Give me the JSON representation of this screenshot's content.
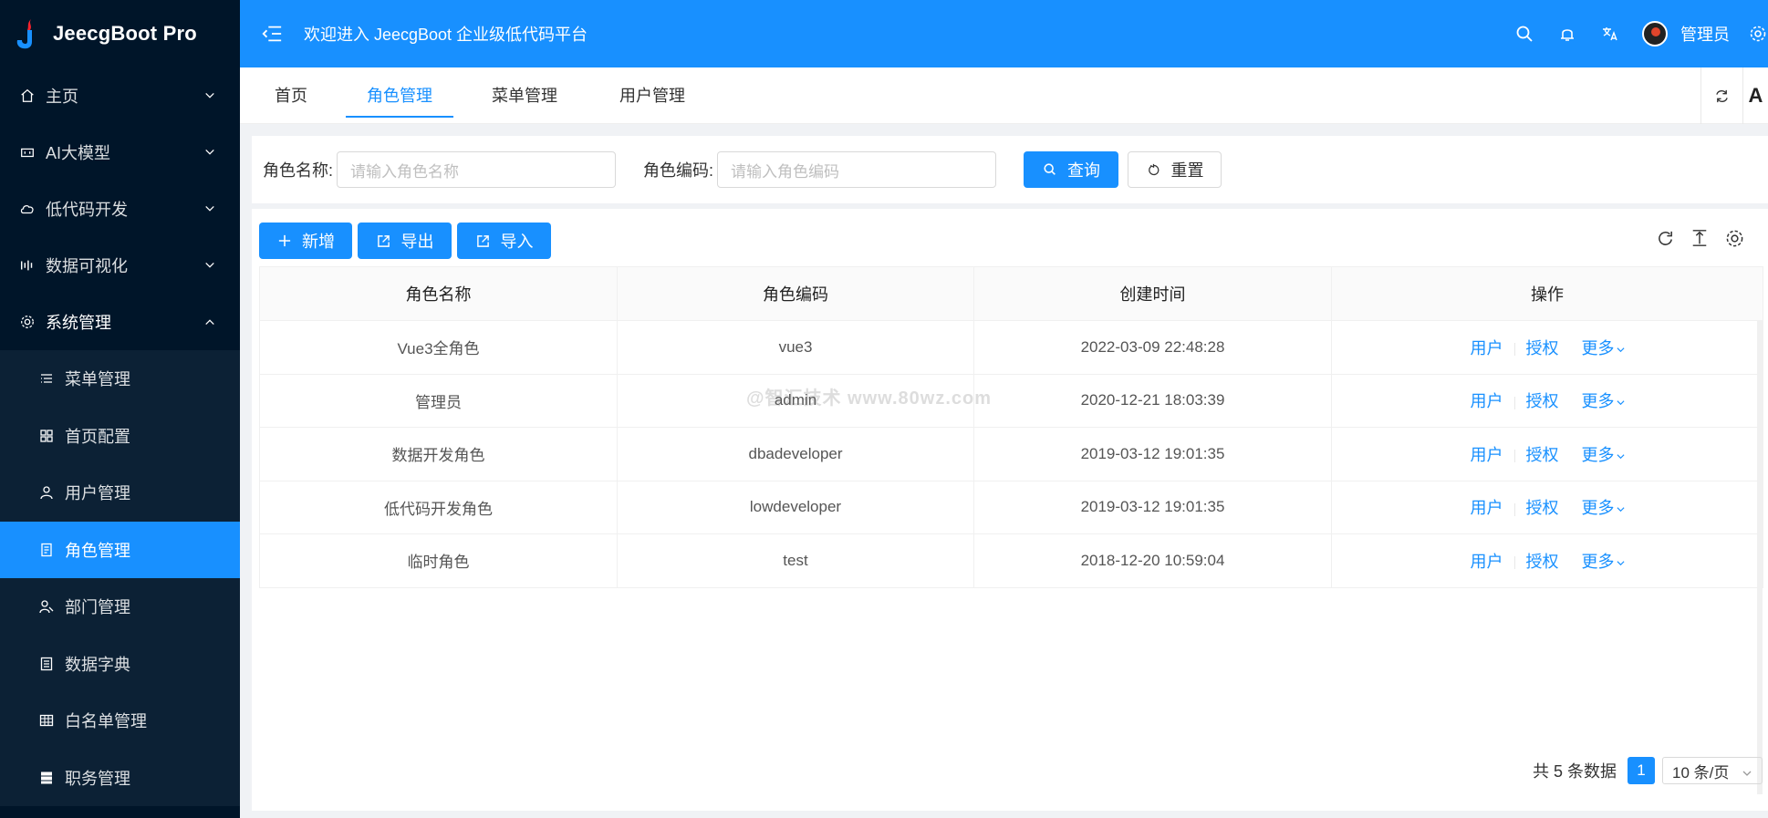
{
  "app": {
    "title": "JeecgBoot Pro",
    "welcome": "欢迎进入 JeecgBoot 企业级低代码平台",
    "username": "管理员"
  },
  "sidebar": {
    "groups": [
      {
        "label": "主页",
        "icon": "home-icon"
      },
      {
        "label": "AI大模型",
        "icon": "ai-icon"
      },
      {
        "label": "低代码开发",
        "icon": "cloud-icon"
      },
      {
        "label": "数据可视化",
        "icon": "chart-icon"
      },
      {
        "label": "系统管理",
        "icon": "gear-icon"
      }
    ],
    "sub_items": [
      {
        "label": "菜单管理",
        "icon": "menu-list-icon"
      },
      {
        "label": "首页配置",
        "icon": "grid-icon"
      },
      {
        "label": "用户管理",
        "icon": "user-icon"
      },
      {
        "label": "角色管理",
        "icon": "role-icon"
      },
      {
        "label": "部门管理",
        "icon": "department-icon"
      },
      {
        "label": "数据字典",
        "icon": "dictionary-icon"
      },
      {
        "label": "白名单管理",
        "icon": "table-icon"
      },
      {
        "label": "职务管理",
        "icon": "position-icon"
      }
    ]
  },
  "tabs": [
    "首页",
    "角色管理",
    "菜单管理",
    "用户管理"
  ],
  "tab_tool_letter": "A",
  "search": {
    "role_name_label": "角色名称:",
    "role_name_placeholder": "请输入角色名称",
    "role_code_label": "角色编码:",
    "role_code_placeholder": "请输入角色编码",
    "query_label": "查询",
    "reset_label": "重置"
  },
  "toolbar": {
    "add_label": "新增",
    "export_label": "导出",
    "import_label": "导入"
  },
  "table": {
    "columns": [
      "角色名称",
      "角色编码",
      "创建时间",
      "操作"
    ],
    "rows": [
      {
        "name": "Vue3全角色",
        "code": "vue3",
        "created": "2022-03-09 22:48:28"
      },
      {
        "name": "管理员",
        "code": "admin",
        "created": "2020-12-21 18:03:39"
      },
      {
        "name": "数据开发角色",
        "code": "dbadeveloper",
        "created": "2019-03-12 19:01:35"
      },
      {
        "name": "低代码开发角色",
        "code": "lowdeveloper",
        "created": "2019-03-12 19:01:35"
      },
      {
        "name": "临时角色",
        "code": "test",
        "created": "2018-12-20 10:59:04"
      }
    ],
    "actions": {
      "users": "用户",
      "authorize": "授权",
      "more": "更多"
    }
  },
  "pagination": {
    "total_text": "共 5 条数据",
    "current_page": "1",
    "page_size": "10 条/页"
  },
  "watermark": "@智汇技术  www.80wz.com",
  "colors": {
    "primary": "#1890ff",
    "sidebar_bg": "#001529",
    "submenu_bg": "#0c2135"
  }
}
